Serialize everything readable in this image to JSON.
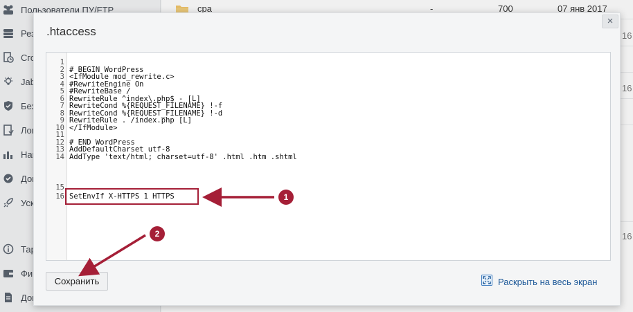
{
  "sidebar": {
    "items": [
      {
        "label": "Пользователи ПУ/FTP",
        "icon": "users-icon"
      },
      {
        "label": "Рез",
        "icon": "database-icon"
      },
      {
        "label": "Сго",
        "icon": "clock-file-icon"
      },
      {
        "label": "Jab",
        "icon": "bulb-icon"
      },
      {
        "label": "Без",
        "icon": "shield-icon"
      },
      {
        "label": "Лог",
        "icon": "log-file-icon"
      },
      {
        "label": "Наг",
        "icon": "bar-chart-icon"
      },
      {
        "label": "Доп",
        "icon": "gear-check-icon"
      },
      {
        "label": "Уск",
        "icon": "rocket-icon"
      },
      {
        "label": "Тар",
        "icon": "info-icon"
      },
      {
        "label": "Фин",
        "icon": "wallet-icon"
      },
      {
        "label": "Док",
        "icon": "document-icon"
      }
    ]
  },
  "file_list": {
    "top_row": {
      "name": "cpa",
      "dash": "-",
      "size": "700",
      "date": "07 янв 2017"
    },
    "fragments": [
      "16",
      "16",
      "16"
    ]
  },
  "modal": {
    "title": ".htaccess",
    "close_label": "×",
    "line_numbers": [
      "1",
      "2",
      "3",
      "4",
      "5",
      "6",
      "7",
      "8",
      "9",
      "10",
      "11",
      "12",
      "13",
      "14",
      "15",
      "16"
    ],
    "lines": [
      "",
      "# BEGIN WordPress",
      "<IfModule mod_rewrite.c>",
      "#RewriteEngine On",
      "#RewriteBase /",
      "RewriteRule ^index\\.php$ - [L]",
      "RewriteCond %{REQUEST_FILENAME} !-f",
      "RewriteCond %{REQUEST_FILENAME} !-d",
      "RewriteRule . /index.php [L]",
      "</IfModule>",
      "",
      "# END WordPress",
      "AddDefaultCharset utf-8",
      "AddType 'text/html; charset=utf-8' .html .htm .shtml",
      "",
      "SetEnvIf X-HTTPS 1 HTTPS"
    ],
    "annotations": {
      "badge_1": "1",
      "badge_2": "2",
      "accent_color": "#a51f37"
    },
    "save_label": "Сохранить",
    "expand_label": "Раскрыть на весь экран"
  }
}
